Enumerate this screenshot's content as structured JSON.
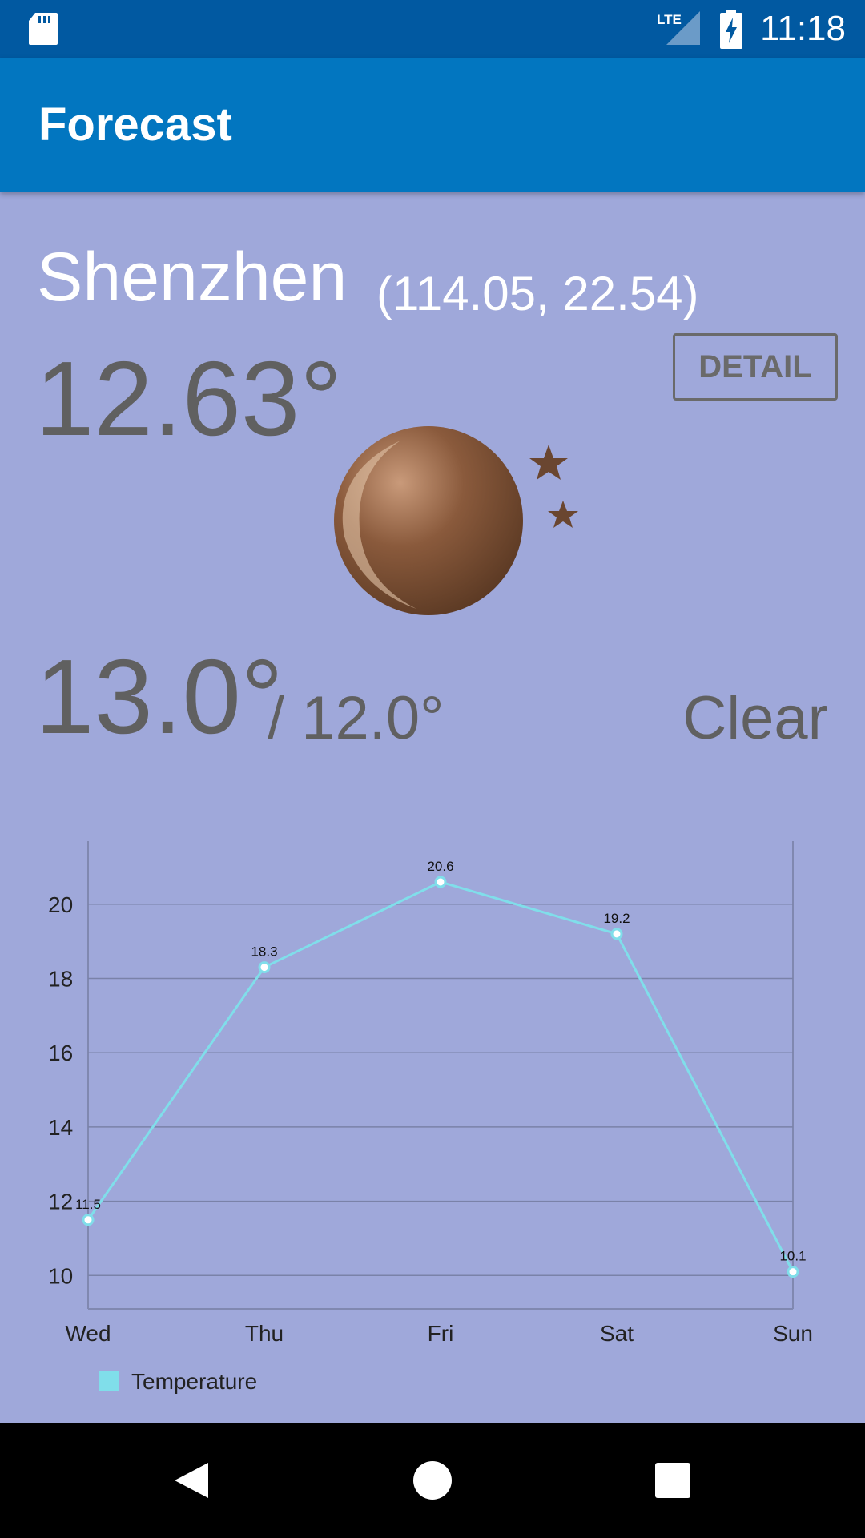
{
  "status_bar": {
    "time": "11:18",
    "network": "LTE",
    "icons": [
      "sd-card-icon",
      "lte-signal-icon",
      "battery-charging-icon"
    ]
  },
  "app_bar": {
    "title": "Forecast"
  },
  "location": {
    "city": "Shenzhen",
    "coordinates": "(114.05,  22.54)"
  },
  "current": {
    "temperature": "12.63°",
    "icon": "clear-night-icon",
    "high": "13.0°",
    "low": "/ 12.0°",
    "condition": "Clear"
  },
  "actions": {
    "detail_label": "DETAIL"
  },
  "colors": {
    "status_bar": "#0159a1",
    "app_bar": "#0276c0",
    "background": "#9fa8da",
    "series": "#80deea"
  },
  "chart_data": {
    "type": "line",
    "categories": [
      "Wed",
      "Thu",
      "Fri",
      "Sat",
      "Sun"
    ],
    "series": [
      {
        "name": "Temperature",
        "values": [
          11.5,
          18.3,
          20.6,
          19.2,
          10.1
        ]
      }
    ],
    "data_labels": [
      "11.5",
      "18.3",
      "20.6",
      "19.2",
      "10.1"
    ],
    "yticks": [
      10,
      12,
      14,
      16,
      18,
      20
    ],
    "ylim": [
      9.1,
      21.7
    ],
    "grid": "horizontal",
    "legend": "bottom-left"
  },
  "nav_bar": {
    "buttons": [
      "back-icon",
      "home-icon",
      "recents-icon"
    ]
  }
}
